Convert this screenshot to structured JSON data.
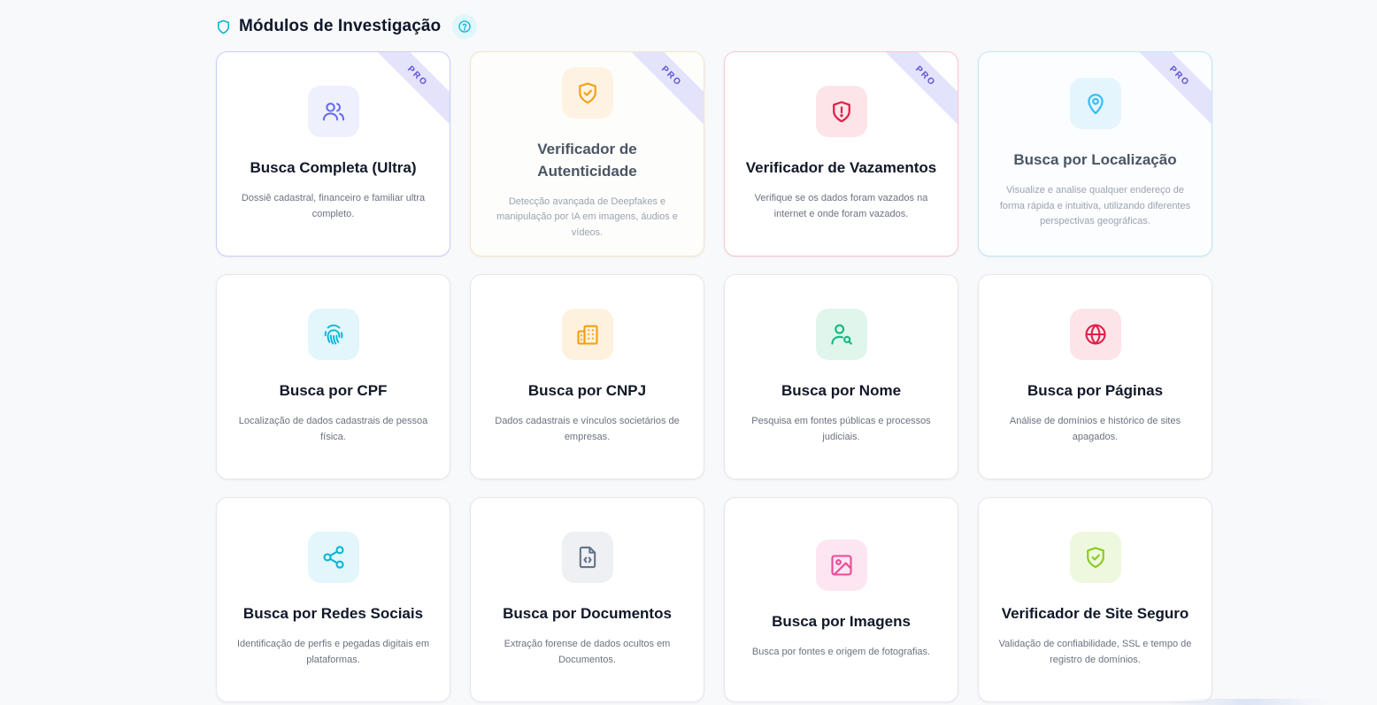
{
  "header": {
    "title": "Módulos de Investigação",
    "title_icon": "shield-icon",
    "help_icon": "help-circle-icon"
  },
  "modules": [
    {
      "title": "Busca Completa (Ultra)",
      "description": "Dossiê cadastral, financeiro e familiar ultra completo.",
      "badge": "PRO",
      "icon": "users-icon",
      "color": "#6366f1"
    },
    {
      "title": "Verificador de Autenticidade",
      "description": "Detecção avançada de Deepfakes e manipulação por IA em imagens, áudios e vídeos.",
      "badge": "PRO",
      "icon": "shield-check-icon",
      "color": "#f59e0b"
    },
    {
      "title": "Verificador de Vazamentos",
      "description": "Verifique se os dados foram vazados na internet e onde foram vazados.",
      "badge": "PRO",
      "icon": "shield-alert-icon",
      "color": "#e11d48"
    },
    {
      "title": "Busca por Localização",
      "description": "Visualize e analise qualquer endereço de forma rápida e intuitiva, utilizando diferentes perspectivas geográficas.",
      "badge": "PRO",
      "icon": "map-pin-icon",
      "color": "#38bdf8"
    },
    {
      "title": "Busca por CPF",
      "description": "Localização de dados cadastrais de pessoa física.",
      "icon": "fingerprint-icon",
      "color": "#06b6d4"
    },
    {
      "title": "Busca por CNPJ",
      "description": "Dados cadastrais e vínculos societários de empresas.",
      "icon": "building-icon",
      "color": "#f59e0b"
    },
    {
      "title": "Busca por Nome",
      "description": "Pesquisa em fontes públicas e processos judiciais.",
      "icon": "user-search-icon",
      "color": "#10b981"
    },
    {
      "title": "Busca por Páginas",
      "description": "Análise de domínios e histórico de sites apagados.",
      "icon": "globe-icon",
      "color": "#e11d48"
    },
    {
      "title": "Busca por Redes Sociais",
      "description": "Identificação de perfis e pegadas digitais em plataformas.",
      "icon": "share-icon",
      "color": "#06b6d4"
    },
    {
      "title": "Busca por Documentos",
      "description": "Extração forense de dados ocultos em Documentos.",
      "icon": "file-code-icon",
      "color": "#64748b"
    },
    {
      "title": "Busca por Imagens",
      "description": "Busca por fontes e origem de fotografias.",
      "icon": "image-icon",
      "color": "#ec4899"
    },
    {
      "title": "Verificador de Site Seguro",
      "description": "Validação de confiabilidade, SSL e tempo de registro de domínios.",
      "icon": "shield-check-icon",
      "color": "#84cc16"
    }
  ]
}
